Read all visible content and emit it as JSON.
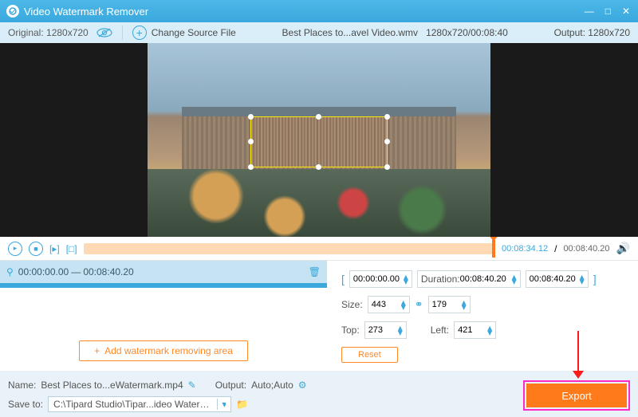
{
  "titlebar": {
    "title": "Video Watermark Remover"
  },
  "subbar": {
    "original": "Original: 1280x720",
    "change_source": "Change Source File",
    "filename": "Best Places to...avel Video.wmv",
    "fileres": "1280x720/00:08:40",
    "output": "Output: 1280x720"
  },
  "playbar": {
    "current": "00:08:34.12",
    "duration": "00:08:40.20"
  },
  "segment": {
    "start": "00:00:00.00",
    "sep": "—",
    "end": "00:08:40.20"
  },
  "add_area": "Add watermark removing area",
  "range": {
    "start": "00:00:00.00",
    "dur_label": "Duration:",
    "dur_val": "00:08:40.20",
    "end": "00:08:40.20"
  },
  "size": {
    "label": "Size:",
    "w": "443",
    "h": "179"
  },
  "pos": {
    "top_label": "Top:",
    "top": "273",
    "left_label": "Left:",
    "left": "421"
  },
  "reset": "Reset",
  "footer": {
    "name_label": "Name:",
    "name": "Best Places to...eWatermark.mp4",
    "output_label": "Output:",
    "output_val": "Auto;Auto",
    "save_label": "Save to:",
    "save_path": "C:\\Tipard Studio\\Tipar...ideo Watermark Remover"
  },
  "export": "Export"
}
